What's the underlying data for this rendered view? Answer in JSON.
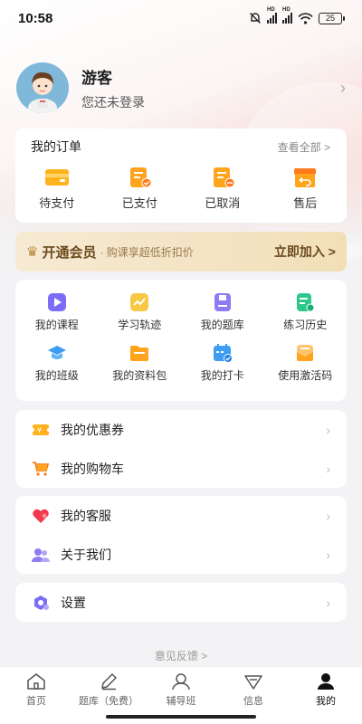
{
  "status_bar": {
    "time": "10:58",
    "battery": "25"
  },
  "profile": {
    "name": "游客",
    "subtitle": "您还未登录"
  },
  "orders": {
    "title": "我的订单",
    "view_all": "查看全部 >",
    "items": [
      {
        "label": "待支付",
        "icon": "wallet-icon"
      },
      {
        "label": "已支付",
        "icon": "paid-document-icon"
      },
      {
        "label": "已取消",
        "icon": "cancelled-document-icon"
      },
      {
        "label": "售后",
        "icon": "return-box-icon"
      }
    ]
  },
  "vip": {
    "title": "开通会员",
    "subtitle": "· 购课享超低折扣价",
    "join": "立即加入 >"
  },
  "features": [
    {
      "label": "我的课程",
      "icon": "course-play-icon",
      "color": "#7b6ef6"
    },
    {
      "label": "学习轨迹",
      "icon": "trend-icon",
      "color": "#f7c843"
    },
    {
      "label": "我的题库",
      "icon": "question-bank-icon",
      "color": "#8d7cf2"
    },
    {
      "label": "练习历史",
      "icon": "history-icon",
      "color": "#2ec98a"
    },
    {
      "label": "我的班级",
      "icon": "graduation-cap-icon",
      "color": "#3e9df2"
    },
    {
      "label": "我的资料包",
      "icon": "folder-icon",
      "color": "#ffa41c"
    },
    {
      "label": "我的打卡",
      "icon": "calendar-check-icon",
      "color": "#3e9df2"
    },
    {
      "label": "使用激活码",
      "icon": "activation-envelope-icon",
      "color": "#ffa41c"
    }
  ],
  "list_group_1": [
    {
      "label": "我的优惠券",
      "icon": "coupon-icon"
    },
    {
      "label": "我的购物车",
      "icon": "cart-icon"
    }
  ],
  "list_group_2": [
    {
      "label": "我的客服",
      "icon": "heart-icon"
    },
    {
      "label": "关于我们",
      "icon": "users-icon"
    }
  ],
  "list_group_3": [
    {
      "label": "设置",
      "icon": "settings-icon"
    }
  ],
  "feedback": "意见反馈 >",
  "tabs": [
    {
      "label": "首页",
      "icon": "home-icon"
    },
    {
      "label": "题库（免费）",
      "icon": "pencil-icon"
    },
    {
      "label": "辅导班",
      "icon": "tutor-icon"
    },
    {
      "label": "信息",
      "icon": "message-icon"
    },
    {
      "label": "我的",
      "icon": "profile-icon",
      "active": true
    }
  ]
}
